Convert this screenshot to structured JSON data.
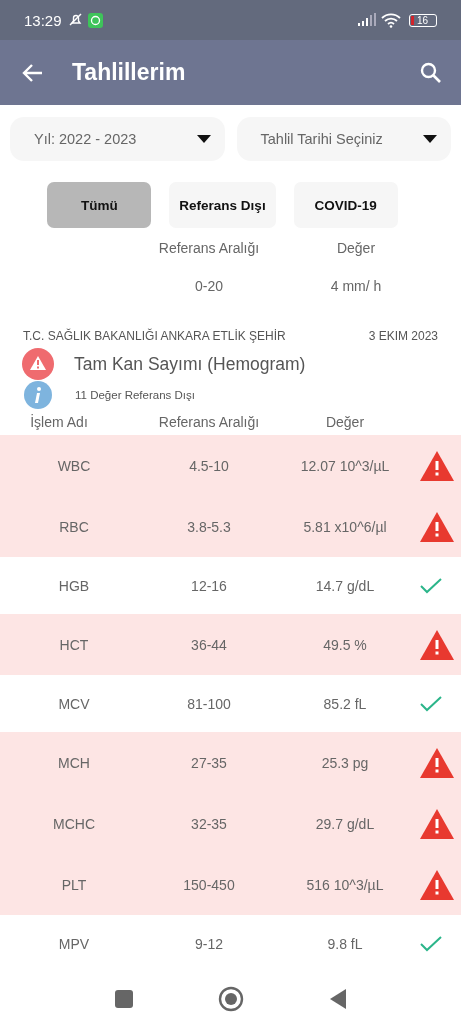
{
  "status_bar": {
    "time": "13:29",
    "battery": "16"
  },
  "app_bar": {
    "title": "Tahlillerim"
  },
  "dropdowns": [
    {
      "value": "Yıl: 2022 - 2023"
    },
    {
      "value": "Tahlil Tarihi Seçiniz"
    }
  ],
  "filters": [
    {
      "label": "Tümü",
      "selected": true
    },
    {
      "label": "Referans Dışı",
      "selected": false
    },
    {
      "label": "COVID-19",
      "selected": false
    }
  ],
  "previous_result": {
    "columns": [
      "Referans Aralığı",
      "Değer"
    ],
    "values": [
      "0-20",
      "4 mm/ h"
    ]
  },
  "report": {
    "institution": "T.C. SAĞLIK BAKANLIĞI ANKARA ETLİK ŞEHİR",
    "date": "3 EKIM 2023",
    "title": "Tam Kan Sayımı (Hemogram)",
    "summary": "11 Değer Referans Dışı",
    "columns": [
      "İşlem Adı",
      "Referans Aralığı",
      "Değer"
    ],
    "rows": [
      {
        "name": "WBC",
        "range": "4.5-10",
        "value": "12.07 10^3/µL",
        "out_of_range": true
      },
      {
        "name": "RBC",
        "range": "3.8-5.3",
        "value": "5.81 x10^6/µl",
        "out_of_range": true
      },
      {
        "name": "HGB",
        "range": "12-16",
        "value": "14.7 g/dL",
        "out_of_range": false
      },
      {
        "name": "HCT",
        "range": "36-44",
        "value": "49.5 %",
        "out_of_range": true
      },
      {
        "name": "MCV",
        "range": "81-100",
        "value": "85.2 fL",
        "out_of_range": false
      },
      {
        "name": "MCH",
        "range": "27-35",
        "value": "25.3 pg",
        "out_of_range": true
      },
      {
        "name": "MCHC",
        "range": "32-35",
        "value": "29.7 g/dL",
        "out_of_range": true
      },
      {
        "name": "PLT",
        "range": "150-450",
        "value": "516 10^3/µL",
        "out_of_range": true
      },
      {
        "name": "MPV",
        "range": "9-12",
        "value": "9.8 fL",
        "out_of_range": false
      }
    ]
  }
}
